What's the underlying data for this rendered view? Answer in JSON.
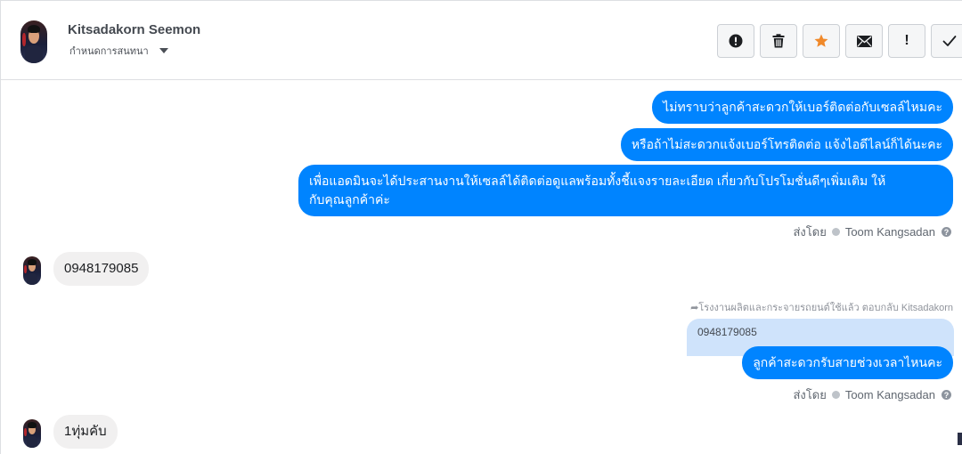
{
  "header": {
    "contact_name": "Kitsadakorn Seemon",
    "subtitle": "กำหนดการสนทนา"
  },
  "toolbar": {
    "buttons": [
      {
        "icon": "alert-circle-icon"
      },
      {
        "icon": "trash-icon"
      },
      {
        "icon": "star-icon",
        "color": "#f0892a"
      },
      {
        "icon": "envelope-icon"
      },
      {
        "label": "!"
      },
      {
        "icon": "checkmark-icon"
      }
    ]
  },
  "messages": {
    "out1": "ไม่ทราบว่าลูกค้าสะดวกให้เบอร์ติดต่อกับเซลล์ไหมคะ",
    "out2": "หรือถ้าไม่สะดวกแจ้งเบอร์โทรติดต่อ แจ้งไอดีไลน์ก็ได้นะคะ",
    "out3_line1": "เพื่อแอดมินจะได้ประสานงานให้เซลล์ได้ติดต่อดูแลพร้อมทั้งชี้แจงรายละเอียด เกี่ยวกับโปรโมชั่นดีๆเพิ่มเติม ให้",
    "out3_line2": "กับคุณลูกค้าค่ะ",
    "sent_by_1_prefix": "ส่งโดย",
    "sent_by_1_name": "Toom Kangsadan",
    "in1": "0948179085",
    "reply_header": "โรงงานผลิตและกระจายรถยนต์ใช้แล้ว ตอบกลับ Kitsadakorn",
    "quoted_text": "0948179085",
    "out4": "ลูกค้าสะดวกรับสายช่วงเวลาไหนคะ",
    "sent_by_2_prefix": "ส่งโดย",
    "sent_by_2_name": "Toom Kangsadan",
    "in2": "1ทุ่มคับ"
  },
  "colors": {
    "outgoing_bubble": "#0084ff",
    "incoming_bubble": "#f1f0f0",
    "quoted_bubble": "#cfe3fb",
    "star": "#f0892a"
  }
}
